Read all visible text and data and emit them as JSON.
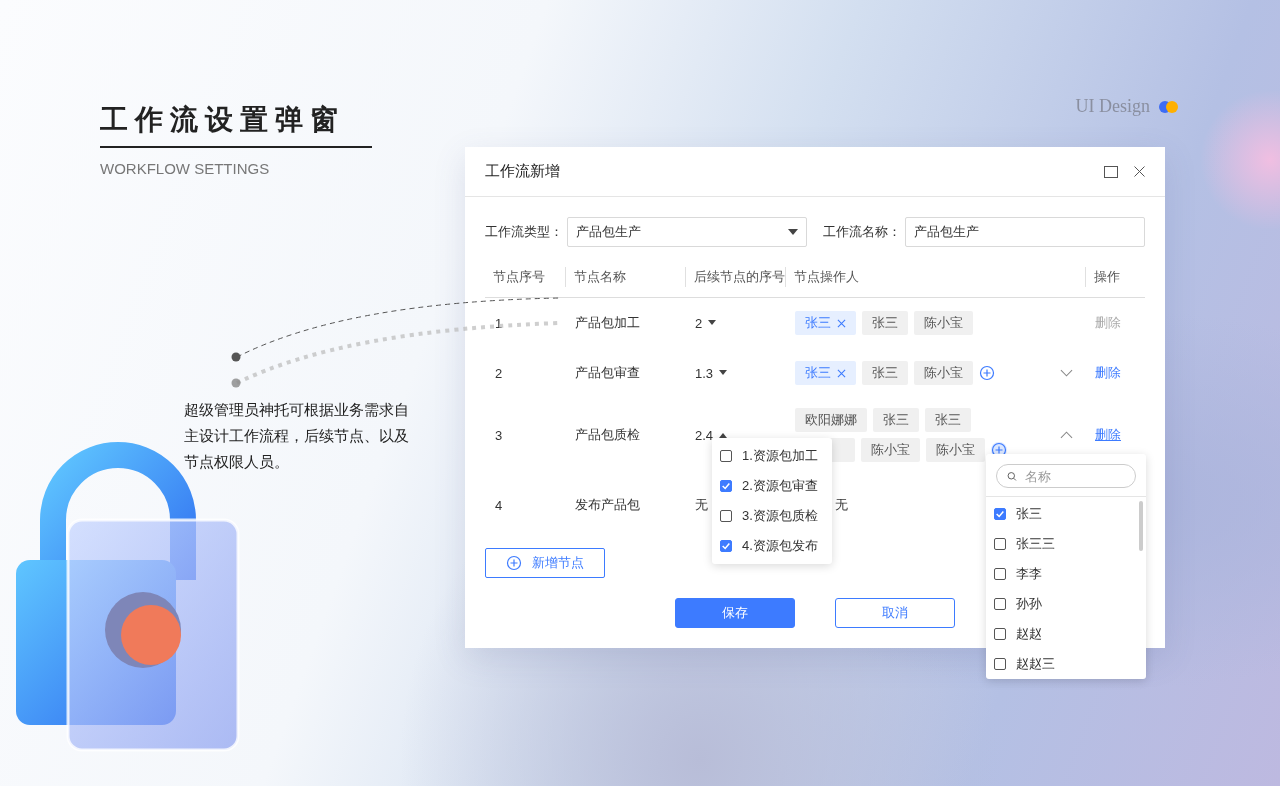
{
  "page": {
    "title": "工作流设置弹窗",
    "subtitle": "WORKFLOW SETTINGS",
    "description": "超级管理员神托可根据业务需求自主设计工作流程，后续节点、以及节点权限人员。",
    "brand": "UI Design"
  },
  "dialog": {
    "title": "工作流新增",
    "form": {
      "type_label": "工作流类型：",
      "type_value": "产品包生产",
      "name_label": "工作流名称：",
      "name_value": "产品包生产"
    },
    "columns": [
      "节点序号",
      "节点名称",
      "后续节点的序号",
      "节点操作人",
      "操作"
    ],
    "rows": [
      {
        "index": "1",
        "name": "产品包加工",
        "successor": "2",
        "successor_open": false,
        "operators": [
          {
            "name": "张三",
            "selected": true
          },
          {
            "name": "张三",
            "selected": false
          },
          {
            "name": "陈小宝",
            "selected": false
          }
        ],
        "add_operator": false,
        "delete": {
          "label": "删除",
          "disabled": true,
          "hovered": false
        }
      },
      {
        "index": "2",
        "name": "产品包审查",
        "successor": "1.3",
        "successor_open": false,
        "operators": [
          {
            "name": "张三",
            "selected": true
          },
          {
            "name": "张三",
            "selected": false
          },
          {
            "name": "陈小宝",
            "selected": false
          }
        ],
        "add_operator": true,
        "add_active": false,
        "expanded": false,
        "delete": {
          "label": "删除",
          "disabled": false,
          "hovered": false
        }
      },
      {
        "index": "3",
        "name": "产品包质检",
        "successor": "2.4",
        "successor_open": true,
        "operators": [
          {
            "name": "欧阳娜娜",
            "selected": false
          },
          {
            "name": "张三",
            "selected": false
          },
          {
            "name": "张三",
            "selected": false
          },
          {
            "covered": true
          },
          {
            "name": "陈小宝",
            "selected": false
          },
          {
            "name": "陈小宝",
            "selected": false
          }
        ],
        "add_operator": true,
        "add_active": true,
        "expanded": true,
        "delete": {
          "label": "删除",
          "disabled": false,
          "hovered": true
        },
        "successor_menu": [
          {
            "label": "1.资源包加工",
            "checked": false
          },
          {
            "label": "2.资源包审查",
            "checked": true
          },
          {
            "label": "3.资源包质检",
            "checked": false
          },
          {
            "label": "4.资源包发布",
            "checked": true
          }
        ],
        "operator_picker": {
          "placeholder": "名称",
          "items": [
            {
              "name": "张三",
              "checked": true
            },
            {
              "name": "张三三",
              "checked": false
            },
            {
              "name": "李李",
              "checked": false
            },
            {
              "name": "孙孙",
              "checked": false
            },
            {
              "name": "赵赵",
              "checked": false
            },
            {
              "name": "赵赵三",
              "checked": false
            }
          ]
        }
      },
      {
        "index": "4",
        "name": "发布产品包",
        "successor_text": "无",
        "operators_text": "无"
      }
    ],
    "add_node": "新增节点",
    "buttons": {
      "save": "保存",
      "cancel": "取消"
    }
  }
}
